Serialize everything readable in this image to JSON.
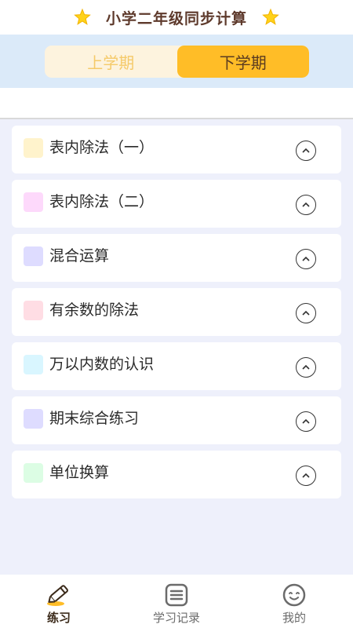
{
  "header": {
    "title": "小学二年级同步计算"
  },
  "terms": {
    "first": "上学期",
    "second": "下学期",
    "active": "second"
  },
  "colors": {
    "accent": "#ffbd27",
    "star": "#ffd21a",
    "title": "#5e3a2c"
  },
  "units": [
    {
      "label": "表内除法（一）",
      "color": "#fff3cc"
    },
    {
      "label": "表内除法（二）",
      "color": "#fdd9fb"
    },
    {
      "label": "混合运算",
      "color": "#dedcff"
    },
    {
      "label": "有余数的除法",
      "color": "#ffdde4"
    },
    {
      "label": "万以内数的认识",
      "color": "#d9f6ff"
    },
    {
      "label": "期末综合练习",
      "color": "#dedcff"
    },
    {
      "label": "单位换算",
      "color": "#dcfde4"
    }
  ],
  "unit_icon": "chevron-up-circle-icon",
  "tabbar": {
    "items": [
      {
        "label": "练习",
        "icon": "pencil-icon",
        "active": true
      },
      {
        "label": "学习记录",
        "icon": "record-list-icon",
        "active": false
      },
      {
        "label": "我的",
        "icon": "smile-face-icon",
        "active": false
      }
    ]
  }
}
